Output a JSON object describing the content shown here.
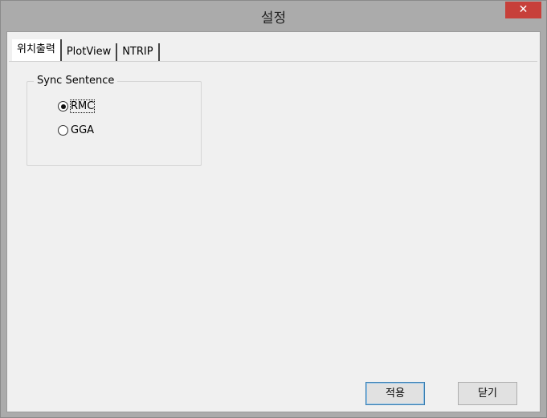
{
  "window": {
    "title": "설정",
    "close_label": "✕"
  },
  "tabs": [
    {
      "label": "위치출력",
      "active": true
    },
    {
      "label": "PlotView",
      "active": false
    },
    {
      "label": "NTRIP",
      "active": false
    }
  ],
  "sync_sentence": {
    "legend": "Sync Sentence",
    "options": [
      {
        "label": "RMC",
        "checked": true
      },
      {
        "label": "GGA",
        "checked": false
      }
    ]
  },
  "buttons": {
    "apply": "적용",
    "close": "닫기"
  },
  "colors": {
    "close_button": "#c7403a",
    "window_frame": "#ababab",
    "dialog_bg": "#f0f0f0"
  }
}
